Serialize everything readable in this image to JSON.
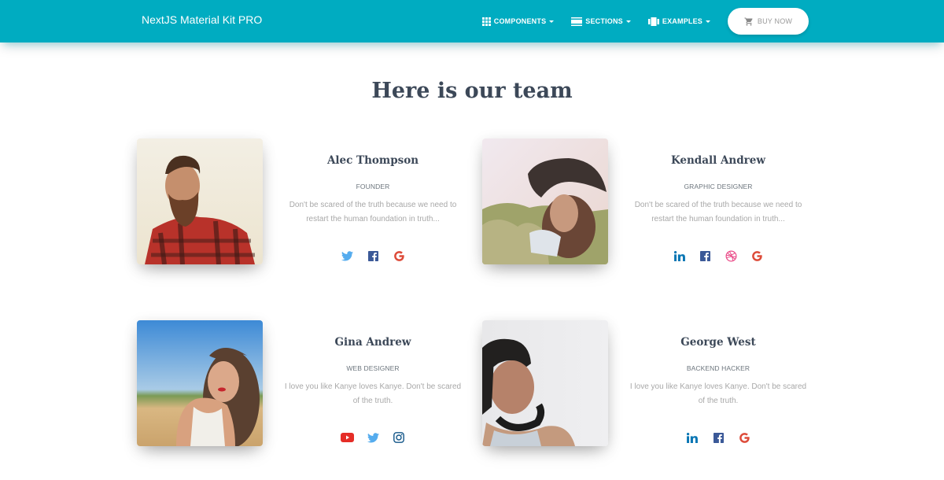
{
  "navbar": {
    "brand": "NextJS Material Kit PRO",
    "links": [
      {
        "label": "COMPONENTS",
        "icon": "apps-grid-icon"
      },
      {
        "label": "SECTIONS",
        "icon": "view-day-icon"
      },
      {
        "label": "EXAMPLES",
        "icon": "carousel-icon"
      }
    ],
    "buy_button": {
      "label": "BUY NOW",
      "icon": "shopping-cart-icon"
    }
  },
  "section": {
    "title": "Here is our team"
  },
  "team": [
    {
      "name": "Alec Thompson",
      "role": "FOUNDER",
      "description": "Don't be scared of the truth because we need to restart the human foundation in truth...",
      "photo": "bearded-man-plaid-shirt",
      "socials": [
        "twitter",
        "facebook",
        "google"
      ]
    },
    {
      "name": "Kendall Andrew",
      "role": "GRAPHIC DESIGNER",
      "description": "Don't be scared of the truth because we need to restart the human foundation in truth...",
      "photo": "woman-black-hat-field",
      "socials": [
        "linkedin",
        "facebook",
        "dribbble",
        "google"
      ]
    },
    {
      "name": "Gina Andrew",
      "role": "WEB DESIGNER",
      "description": "I love you like Kanye loves Kanye. Don't be scared of the truth.",
      "photo": "curly-hair-woman-beach",
      "socials": [
        "youtube",
        "twitter",
        "instagram"
      ]
    },
    {
      "name": "George West",
      "role": "BACKEND HACKER",
      "description": "I love you like Kanye loves Kanye. Don't be scared of the truth.",
      "photo": "man-with-headphones",
      "socials": [
        "linkedin",
        "facebook",
        "google"
      ]
    }
  ],
  "colors": {
    "navbar": "#00acc1",
    "title": "#3c4858",
    "twitter": "#55acee",
    "facebook": "#3b5998",
    "google": "#dd4b39",
    "linkedin": "#0976b4",
    "dribbble": "#ea4c89",
    "youtube": "#e52d27",
    "instagram": "#125688"
  }
}
